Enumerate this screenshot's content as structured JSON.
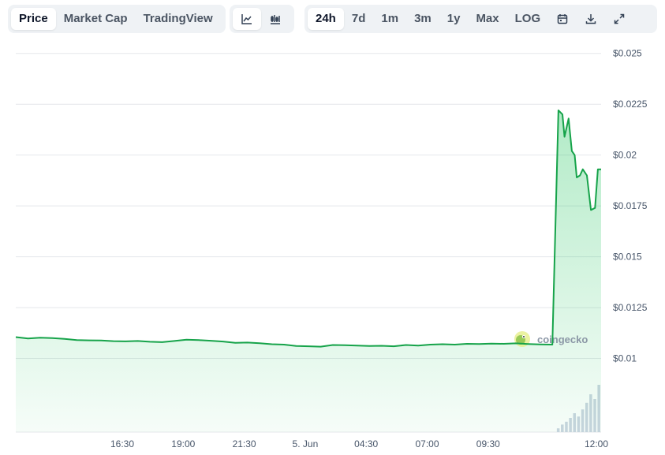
{
  "toolbar": {
    "tabs": [
      {
        "label": "Price",
        "active": true
      },
      {
        "label": "Market Cap",
        "active": false
      },
      {
        "label": "TradingView",
        "active": false
      }
    ],
    "chart_types": [
      {
        "icon": "line-chart-icon",
        "active": true
      },
      {
        "icon": "candlestick-chart-icon",
        "active": false
      }
    ],
    "ranges": [
      {
        "label": "24h",
        "active": true
      },
      {
        "label": "7d",
        "active": false
      },
      {
        "label": "1m",
        "active": false
      },
      {
        "label": "3m",
        "active": false
      },
      {
        "label": "1y",
        "active": false
      },
      {
        "label": "Max",
        "active": false
      },
      {
        "label": "LOG",
        "active": false
      }
    ],
    "tools": [
      "calendar-icon",
      "download-icon",
      "expand-icon"
    ]
  },
  "watermark": {
    "text": "coingecko"
  },
  "colors": {
    "line": "#16a34a",
    "fill": "#22c55e",
    "grid": "#e5e7eb",
    "volume": "#cbd5e1"
  },
  "chart_data": {
    "type": "area",
    "title": "",
    "xlabel": "",
    "ylabel": "",
    "x_ticks": [
      "16:30",
      "19:00",
      "21:30",
      "5. Jun",
      "04:30",
      "07:00",
      "09:30",
      "12:00"
    ],
    "y_ticks": [
      "$0.01",
      "$0.0125",
      "$0.015",
      "$0.0175",
      "$0.02",
      "$0.0225",
      "$0.025"
    ],
    "ylim": [
      0.0094,
      0.0253
    ],
    "xlim": [
      "2024-06-04T12:00",
      "2024-06-05T12:00"
    ],
    "grid": true,
    "series": [
      {
        "points": [
          [
            "2024-06-04T12:00",
            0.01105
          ],
          [
            "2024-06-04T12:30",
            0.01098
          ],
          [
            "2024-06-04T13:00",
            0.01102
          ],
          [
            "2024-06-04T13:30",
            0.011
          ],
          [
            "2024-06-04T14:00",
            0.01096
          ],
          [
            "2024-06-04T14:30",
            0.0109
          ],
          [
            "2024-06-04T15:00",
            0.01089
          ],
          [
            "2024-06-04T15:30",
            0.01088
          ],
          [
            "2024-06-04T16:00",
            0.01085
          ],
          [
            "2024-06-04T16:30",
            0.01084
          ],
          [
            "2024-06-04T17:00",
            0.01086
          ],
          [
            "2024-06-04T17:30",
            0.01082
          ],
          [
            "2024-06-04T18:00",
            0.0108
          ],
          [
            "2024-06-04T18:30",
            0.01086
          ],
          [
            "2024-06-04T19:00",
            0.01092
          ],
          [
            "2024-06-04T19:30",
            0.0109
          ],
          [
            "2024-06-04T20:00",
            0.01087
          ],
          [
            "2024-06-04T20:30",
            0.01083
          ],
          [
            "2024-06-04T21:00",
            0.01077
          ],
          [
            "2024-06-04T21:30",
            0.01078
          ],
          [
            "2024-06-04T22:00",
            0.01075
          ],
          [
            "2024-06-04T22:30",
            0.0107
          ],
          [
            "2024-06-04T23:00",
            0.01068
          ],
          [
            "2024-06-04T23:30",
            0.01061
          ],
          [
            "2024-06-05T00:00",
            0.0106
          ],
          [
            "2024-06-05T00:30",
            0.01058
          ],
          [
            "2024-06-05T01:00",
            0.01066
          ],
          [
            "2024-06-05T01:30",
            0.01065
          ],
          [
            "2024-06-05T02:00",
            0.01063
          ],
          [
            "2024-06-05T02:30",
            0.01061
          ],
          [
            "2024-06-05T03:00",
            0.01062
          ],
          [
            "2024-06-05T03:30",
            0.0106
          ],
          [
            "2024-06-05T04:00",
            0.01066
          ],
          [
            "2024-06-05T04:30",
            0.01063
          ],
          [
            "2024-06-05T05:00",
            0.01068
          ],
          [
            "2024-06-05T05:30",
            0.0107
          ],
          [
            "2024-06-05T06:00",
            0.01068
          ],
          [
            "2024-06-05T06:30",
            0.01072
          ],
          [
            "2024-06-05T07:00",
            0.01071
          ],
          [
            "2024-06-05T07:30",
            0.01073
          ],
          [
            "2024-06-05T08:00",
            0.01072
          ],
          [
            "2024-06-05T08:30",
            0.01074
          ],
          [
            "2024-06-05T09:00",
            0.01071
          ],
          [
            "2024-06-05T09:30",
            0.01069
          ],
          [
            "2024-06-05T10:00",
            0.01068
          ],
          [
            "2024-06-05T10:15",
            0.0222
          ],
          [
            "2024-06-05T10:25",
            0.022
          ],
          [
            "2024-06-05T10:30",
            0.0209
          ],
          [
            "2024-06-05T10:40",
            0.0218
          ],
          [
            "2024-06-05T10:48",
            0.0202
          ],
          [
            "2024-06-05T10:55",
            0.02
          ],
          [
            "2024-06-05T11:00",
            0.0189
          ],
          [
            "2024-06-05T11:08",
            0.019
          ],
          [
            "2024-06-05T11:15",
            0.0193
          ],
          [
            "2024-06-05T11:25",
            0.019
          ],
          [
            "2024-06-05T11:35",
            0.0173
          ],
          [
            "2024-06-05T11:45",
            0.0174
          ],
          [
            "2024-06-05T11:52",
            0.0193
          ],
          [
            "2024-06-05T12:00",
            0.0193
          ]
        ]
      }
    ],
    "volume": {
      "points": [
        [
          "2024-06-05T10:15",
          0.08
        ],
        [
          "2024-06-05T10:25",
          0.16
        ],
        [
          "2024-06-05T10:35",
          0.22
        ],
        [
          "2024-06-05T10:45",
          0.3
        ],
        [
          "2024-06-05T10:55",
          0.4
        ],
        [
          "2024-06-05T11:05",
          0.33
        ],
        [
          "2024-06-05T11:15",
          0.48
        ],
        [
          "2024-06-05T11:25",
          0.62
        ],
        [
          "2024-06-05T11:35",
          0.8
        ],
        [
          "2024-06-05T11:45",
          0.7
        ],
        [
          "2024-06-05T11:55",
          1.0
        ]
      ]
    }
  }
}
